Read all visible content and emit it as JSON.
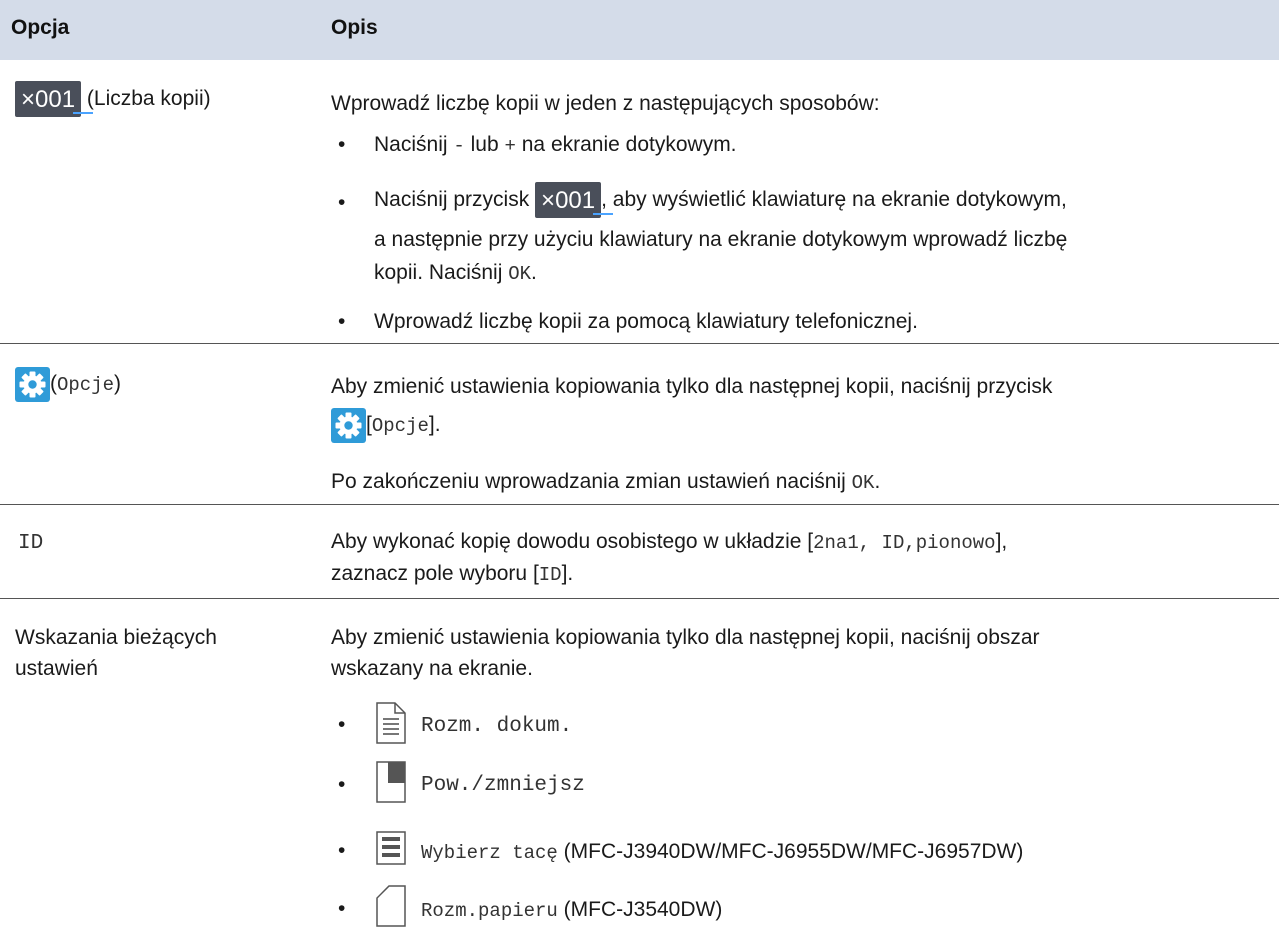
{
  "header": {
    "col1": "Opcja",
    "col2": "Opis"
  },
  "row1": {
    "option_icon_text": "×001",
    "option_label": "(Liczba kopii)",
    "intro": "Wprowadź liczbę kopii w jeden z następujących sposobów:",
    "b1_pre": "Naciśnij",
    "b1_minus": "-",
    "b1_lub": "lub",
    "b1_plus": "+",
    "b1_post": "na ekranie dotykowym.",
    "b2_pre": "Naciśnij przycisk",
    "b2_icon_text": "×001",
    "b2_post": ", aby wyświetlić klawiaturę na ekranie dotykowym,",
    "b2_line2": "a następnie przy użyciu klawiatury na ekranie dotykowym wprowadź liczbę",
    "b2_line3_pre": "kopii. Naciśnij",
    "b2_line3_ok": "OK",
    "b2_line3_post": ".",
    "b3": "Wprowadź liczbę kopii za pomocą klawiatury telefonicznej."
  },
  "row2": {
    "option_open": "(",
    "option_mono": "Opcje",
    "option_close": ")",
    "line1": "Aby zmienić ustawienia kopiowania tylko dla następnej kopii, naciśnij przycisk",
    "line2_open": "[",
    "line2_mono": "Opcje",
    "line2_close": "].",
    "line3_pre": "Po zakończeniu wprowadzania zmian ustawień naciśnij",
    "line3_ok": "OK",
    "line3_post": "."
  },
  "row3": {
    "option_mono": "ID",
    "line1_pre": "Aby wykonać kopię dowodu osobistego w układzie [",
    "line1_mono": "2na1, ID,pionowo",
    "line1_post": "],",
    "line2_pre": "zaznacz pole wyboru [",
    "line2_mono": "ID",
    "line2_post": "]."
  },
  "row4": {
    "option_line1": "Wskazania bieżących",
    "option_line2": "ustawień",
    "line1": "Aby zmienić ustawienia kopiowania tylko dla następnej kopii, naciśnij obszar",
    "line2": "wskazany na ekranie.",
    "items": [
      {
        "icon": "document-size-icon",
        "mono": "Rozm. dokum.",
        "suffix": ""
      },
      {
        "icon": "enlarge-reduce-icon",
        "mono": "Pow./zmniejsz",
        "suffix": ""
      },
      {
        "icon": "tray-select-icon",
        "mono": "Wybierz tacę",
        "suffix": " (MFC-J3940DW/MFC-J6955DW/MFC-J6957DW)"
      },
      {
        "icon": "paper-size-icon",
        "mono": "Rozm.papieru",
        "suffix": " (MFC-J3540DW)"
      }
    ]
  },
  "colors": {
    "header_bg": "#d4dce9",
    "gear_bg": "#2f9bd8",
    "counter_bg": "#4a4f5a",
    "counter_underline": "#4aa3ff"
  }
}
